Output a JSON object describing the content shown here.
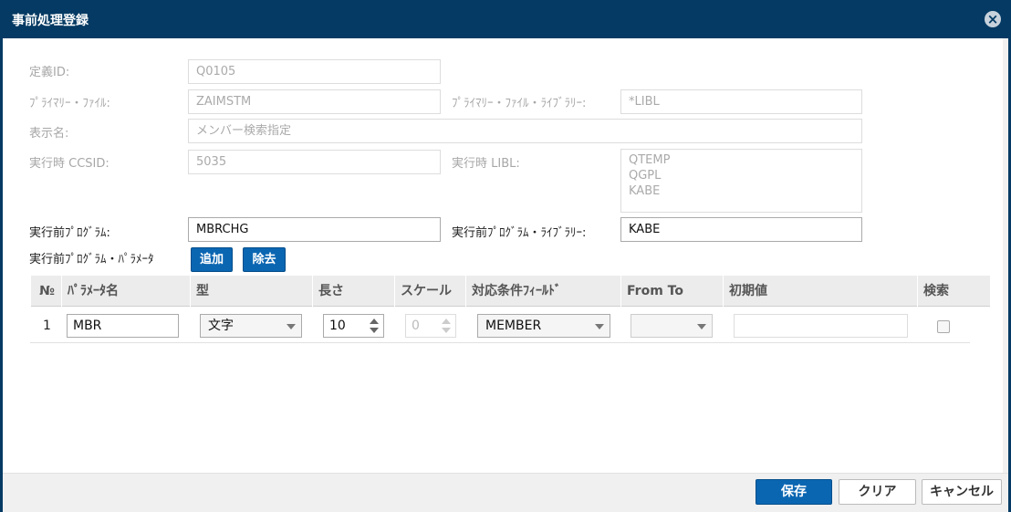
{
  "dialog": {
    "title": "事前処理登録",
    "close_icon": "×"
  },
  "form": {
    "definition_id": {
      "label": "定義ID:",
      "value": "Q0105"
    },
    "primary_file": {
      "label": "ﾌﾟﾗｲﾏﾘｰ・ﾌｧｲﾙ:",
      "value": "ZAIMSTM"
    },
    "primary_file_library": {
      "label": "ﾌﾟﾗｲﾏﾘｰ・ﾌｧｲﾙ・ﾗｲﾌﾞﾗﾘｰ:",
      "value": "*LIBL"
    },
    "display_name": {
      "label": "表示名:",
      "value": "メンバー検索指定"
    },
    "runtime_ccsid": {
      "label": "実行時 CCSID:",
      "value": "5035"
    },
    "runtime_libl": {
      "label": "実行時 LIBL:",
      "values": [
        "QTEMP",
        "QGPL",
        "KABE"
      ]
    },
    "pre_program": {
      "label": "実行前ﾌﾟﾛｸﾞﾗﾑ:",
      "value": "MBRCHG"
    },
    "pre_program_library": {
      "label": "実行前ﾌﾟﾛｸﾞﾗﾑ・ﾗｲﾌﾞﾗﾘｰ:",
      "value": "KABE"
    },
    "pre_program_params": {
      "label": "実行前ﾌﾟﾛｸﾞﾗﾑ・ﾊﾟﾗﾒｰﾀ"
    },
    "add_button": "追加",
    "remove_button": "除去"
  },
  "table": {
    "headers": [
      "№",
      "ﾊﾟﾗﾒｰﾀ名",
      "型",
      "長さ",
      "スケール",
      "対応条件ﾌｨｰﾙﾄﾞ",
      "From To",
      "初期値",
      "検索"
    ],
    "rows": [
      {
        "no": "1",
        "param_name": "MBR",
        "type": "文字",
        "length": "10",
        "scale": "0",
        "field": "MEMBER",
        "from_to": "",
        "initial": "",
        "search": false
      }
    ]
  },
  "footer": {
    "save": "保存",
    "clear": "クリア",
    "cancel": "キャンセル"
  },
  "colors": {
    "title_bar": "#043a63",
    "primary_button": "#0b66b2"
  }
}
